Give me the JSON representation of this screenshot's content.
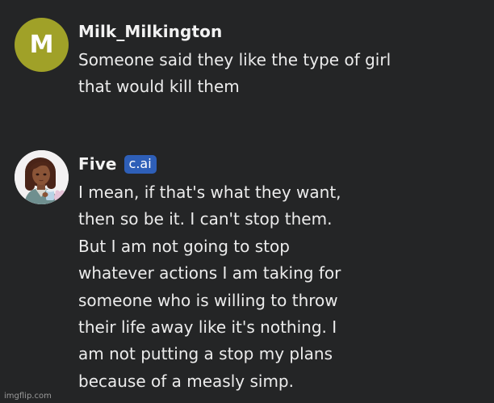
{
  "messages": [
    {
      "username": "Milk_Milkington",
      "avatar_letter": "M",
      "badge": "",
      "lines": [
        "Someone said they like the type of girl",
        "that would kill them"
      ]
    },
    {
      "username": "Five",
      "badge": "c.ai",
      "lines": [
        "I mean, if that's what they want,",
        "then so be it. I can't stop them.",
        "But I am not going to stop",
        "whatever actions I am taking for",
        "someone who is willing to throw",
        "their life away like it's nothing. I",
        "am not putting a stop my plans",
        "because of a measly simp."
      ]
    }
  ],
  "watermark": "imgflip.com",
  "colors": {
    "background": "#242526",
    "avatar_m": "#a0a128",
    "badge": "#2e5fb8"
  }
}
